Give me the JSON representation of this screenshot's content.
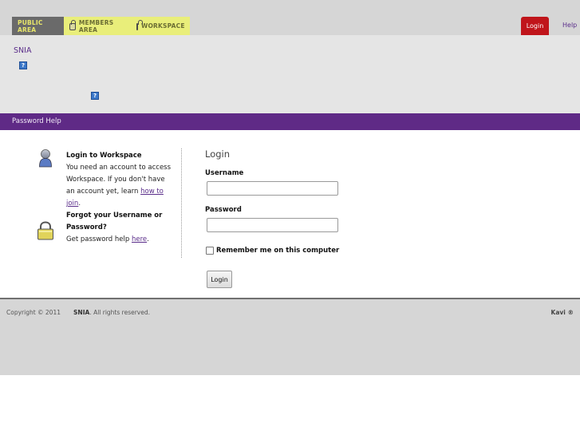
{
  "nav": {
    "tabs": [
      {
        "label": "PUBLIC AREA",
        "locked": false
      },
      {
        "label": "MEMBERS AREA",
        "locked": true
      },
      {
        "label": "WORKSPACE",
        "locked": true
      }
    ],
    "login_label": "Login",
    "help_label": "Help"
  },
  "header": {
    "org_name": "SNIA",
    "help_icon_glyph": "?"
  },
  "subnav": {
    "title": "Password Help"
  },
  "info": {
    "workspace_heading": "Login to Workspace",
    "workspace_text": "You need an account to access Workspace. If you don't have an account yet, learn",
    "workspace_link": "how to join",
    "workspace_after": ".",
    "forgot_heading": "Forgot your Username or Password?",
    "forgot_text": "Get password help",
    "forgot_link": "here",
    "forgot_after": "."
  },
  "login_form": {
    "title": "Login",
    "username_label": "Username",
    "username_value": "",
    "password_label": "Password",
    "password_value": "",
    "remember_label": "Remember me on this computer",
    "remember_checked": false,
    "submit_label": "Login"
  },
  "footer": {
    "copyright": "Copyright © 2011",
    "org": "SNIA",
    "rights": ". All rights reserved.",
    "powered": "Kavi ®"
  },
  "colors": {
    "accent_purple": "#5f2a86",
    "login_red": "#c0151b",
    "tab_yellow": "#e9ee7a"
  },
  "icons": [
    "lock-icon",
    "help-icon",
    "person-icon",
    "padlock-icon"
  ]
}
